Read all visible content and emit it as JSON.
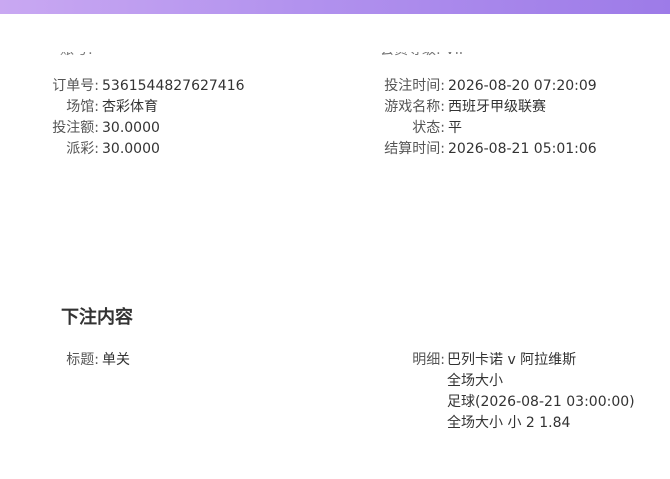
{
  "order": {
    "left": [
      {
        "label": "订单号:",
        "value": "5361544827627416"
      },
      {
        "label": "场馆:",
        "value": "杏彩体育"
      },
      {
        "label": "投注额:",
        "value": "30.0000"
      },
      {
        "label": "派彩:",
        "value": "30.0000"
      }
    ],
    "right": [
      {
        "label": "投注时间:",
        "value": "2026-08-20 07:20:09"
      },
      {
        "label": "游戏名称:",
        "value": "西班牙甲级联赛"
      },
      {
        "label": "状态:",
        "value": "平"
      },
      {
        "label": "结算时间:",
        "value": "2026-08-21 05:01:06"
      }
    ]
  },
  "bet_content": {
    "title": "下注内容",
    "subject_label": "标题:",
    "subject_value": "单关",
    "detail_label": "明细:",
    "detail_lines": [
      "巴列卡诺 v 阿拉维斯",
      "全场大小",
      "足球(2026-08-21 03:00:00)",
      "全场大小 小 2 1.84"
    ]
  },
  "colors": {
    "accent_gradient_start": "#c9a8f2",
    "accent_gradient_end": "#9d7be8"
  }
}
